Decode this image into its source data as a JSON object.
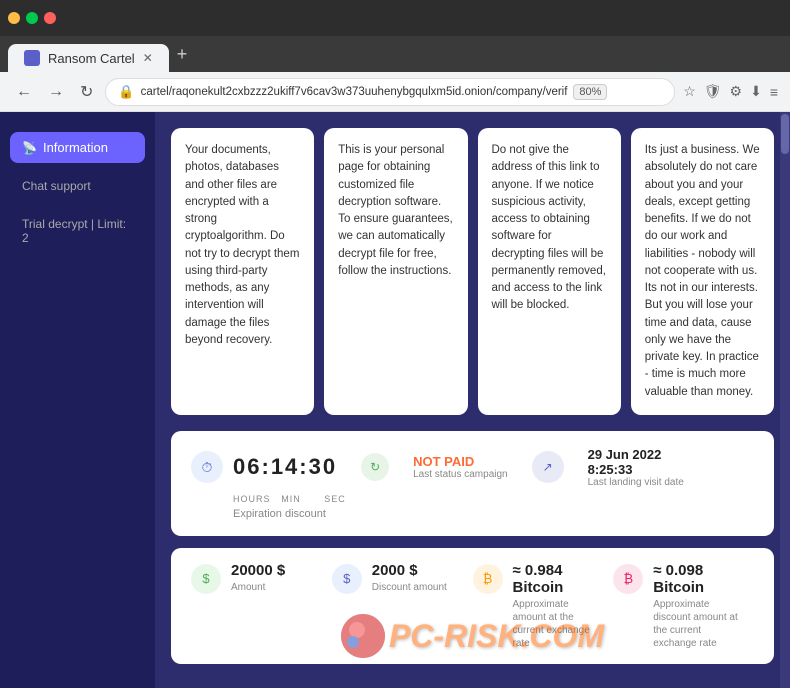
{
  "browser": {
    "tab_title": "Ransom Cartel",
    "url": "cartel/raqonekult2cxbzzz2ukiff7v6cav3w373uuhenybgqulxm5id.onion/company/verif",
    "zoom": "80%"
  },
  "sidebar": {
    "information_label": "Information",
    "chat_label": "Chat support",
    "trial_label": "Trial decrypt | Limit: 2"
  },
  "cards": [
    {
      "text": "Your documents, photos, databases and other files are encrypted with a strong cryptoalgorithm. Do not try to decrypt them using third-party methods, as any intervention will damage the files beyond recovery."
    },
    {
      "text": "This is your personal page for obtaining customized file decryption software. To ensure guarantees, we can automatically decrypt file for free, follow the instructions."
    },
    {
      "text": "Do not give the address of this link to anyone. If we notice suspicious activity, access to obtaining software for decrypting files will be permanently removed, and access to the link will be blocked."
    },
    {
      "text": "Its just a business. We absolutely do not care about you and your deals, except getting benefits. If we do not do our work and liabilities - nobody will not cooperate with us. Its not in our interests. But you will lose your time and data, cause only we have the private key. In practice - time is much more valuable than money."
    }
  ],
  "timer": {
    "hours": "06",
    "minutes": "14",
    "seconds": "30",
    "hours_label": "HOURS",
    "minutes_label": "MIN",
    "seconds_label": "SEC",
    "expiration_label": "Expiration discount"
  },
  "status": {
    "not_paid": "NOT PAID",
    "last_status_label": "Last status campaign"
  },
  "visit_date": {
    "date": "29 Jun 2022",
    "time": "8:25:33",
    "label": "Last landing visit date"
  },
  "amounts": [
    {
      "value": "20000 $",
      "label": "Amount"
    },
    {
      "value": "2000 $",
      "label": "Discount amount"
    },
    {
      "value": "≈ 0.984",
      "unit": "Bitcoin",
      "label": "Approximate amount at the current exchange rate"
    },
    {
      "value": "≈ 0.098",
      "unit": "Bitcoin",
      "label": "Approximate discount amount at the current exchange rate"
    }
  ],
  "watermark": {
    "text": "PC",
    "suffix": "-RISK.COM"
  }
}
